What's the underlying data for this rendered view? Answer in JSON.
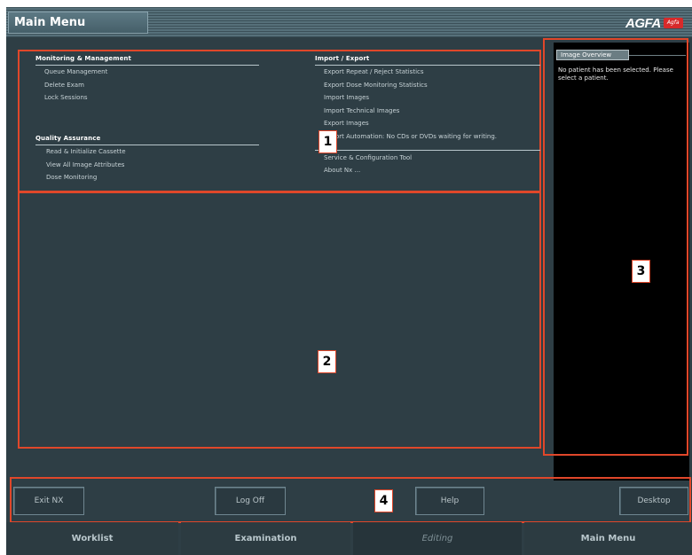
{
  "window": {
    "title": "Main Menu",
    "logo": "AGFA",
    "logo_mark": "Agfa"
  },
  "menu": {
    "monitoring": {
      "heading": "Monitoring & Management",
      "items": [
        "Queue Management",
        "Delete Exam",
        "Lock Sessions"
      ]
    },
    "quality": {
      "heading": "Quality Assurance",
      "items": [
        "Read & Initialize Cassette",
        "View All Image Attributes",
        "Dose Monitoring"
      ]
    },
    "import_export": {
      "heading": "Import / Export",
      "items": [
        "Export Repeat / Reject Statistics",
        "Export Dose Monitoring Statistics",
        "Import Images",
        "Import Technical Images",
        "Export Images",
        "Export Automation: No CDs or DVDs waiting for writing."
      ]
    },
    "tools": {
      "items": [
        "Service & Configuration Tool",
        "About Nx ..."
      ]
    }
  },
  "image_overview": {
    "tab_label": "Image Overview",
    "message": "No patient has been selected. Please select a patient."
  },
  "buttons": {
    "exit": "Exit NX",
    "logoff": "Log Off",
    "help": "Help",
    "desktop": "Desktop"
  },
  "tabs": {
    "worklist": "Worklist",
    "examination": "Examination",
    "editing": "Editing",
    "main_menu": "Main Menu"
  },
  "callouts": {
    "one": "1",
    "two": "2",
    "three": "3",
    "four": "4"
  },
  "colors": {
    "background": "#2e3e45",
    "highlight": "#e0472a",
    "overview_bg": "#000000"
  }
}
